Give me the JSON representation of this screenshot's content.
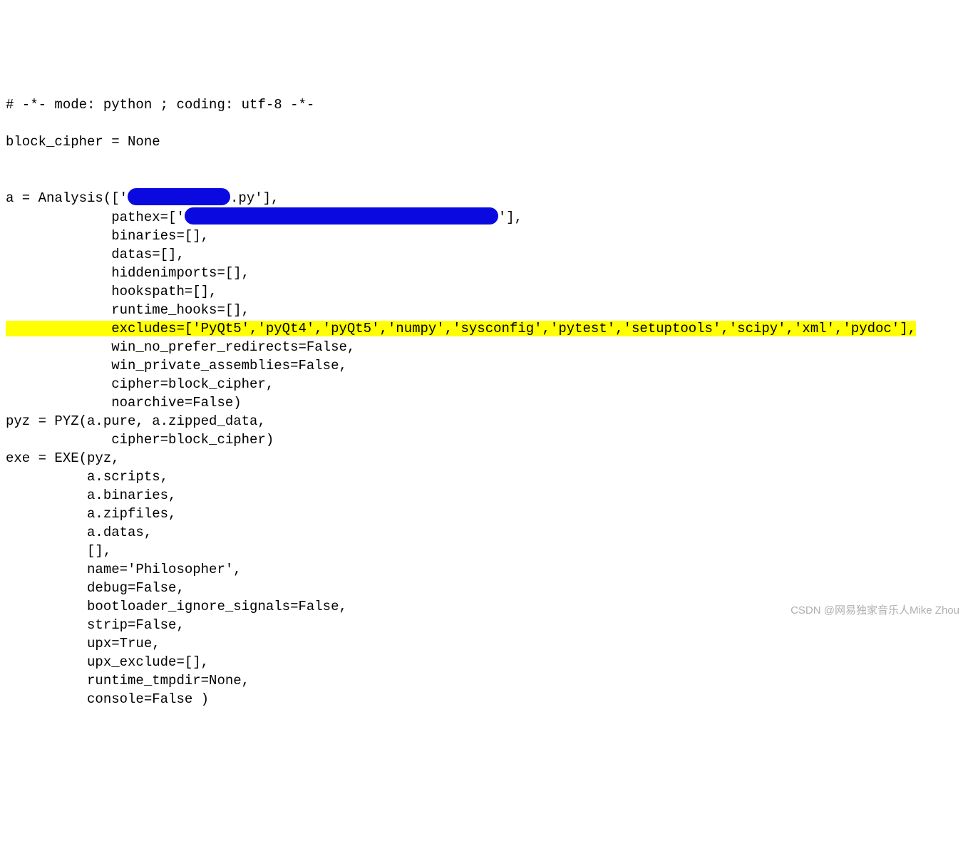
{
  "code": {
    "line1": "# -*- mode: python ; coding: utf-8 -*-",
    "line2": "",
    "line3": "block_cipher = None",
    "line4": "",
    "line5": "",
    "line6_a": "a = Analysis(['",
    "line6_b": ".py'],",
    "line7_a": "             pathex=['",
    "line7_b": "'],",
    "line8": "             binaries=[],",
    "line9": "             datas=[],",
    "line10": "             hiddenimports=[],",
    "line11": "             hookspath=[],",
    "line12": "             runtime_hooks=[],",
    "line13": "             excludes=['PyQt5','pyQt4','pyQt5','numpy','sysconfig','pytest','setuptools','scipy','xml','pydoc'],",
    "line14": "             win_no_prefer_redirects=False,",
    "line15": "             win_private_assemblies=False,",
    "line16": "             cipher=block_cipher,",
    "line17": "             noarchive=False)",
    "line18": "pyz = PYZ(a.pure, a.zipped_data,",
    "line19": "             cipher=block_cipher)",
    "line20": "exe = EXE(pyz,",
    "line21": "          a.scripts,",
    "line22": "          a.binaries,",
    "line23": "          a.zipfiles,",
    "line24": "          a.datas,",
    "line25": "          [],",
    "line26": "          name='Philosopher',",
    "line27": "          debug=False,",
    "line28": "          bootloader_ignore_signals=False,",
    "line29": "          strip=False,",
    "line30": "          upx=True,",
    "line31": "          upx_exclude=[],",
    "line32": "          runtime_tmpdir=None,",
    "line33": "          console=False )"
  },
  "watermark": "CSDN @网易独家音乐人Mike Zhou"
}
